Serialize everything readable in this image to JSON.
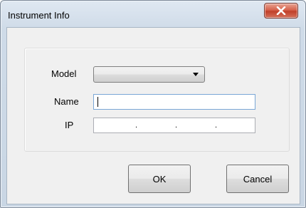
{
  "window": {
    "title": "Instrument Info"
  },
  "form": {
    "model_label": "Model",
    "name_label": "Name",
    "ip_label": "IP",
    "model_value": "",
    "name_value": "",
    "ip_separators": [
      ".",
      ".",
      "."
    ]
  },
  "buttons": {
    "ok": "OK",
    "cancel": "Cancel"
  },
  "icons": {
    "close": "close-icon",
    "dropdown": "chevron-down-icon"
  },
  "colors": {
    "close_button": "#c9452f",
    "titlebar": "#d3dfeb"
  }
}
